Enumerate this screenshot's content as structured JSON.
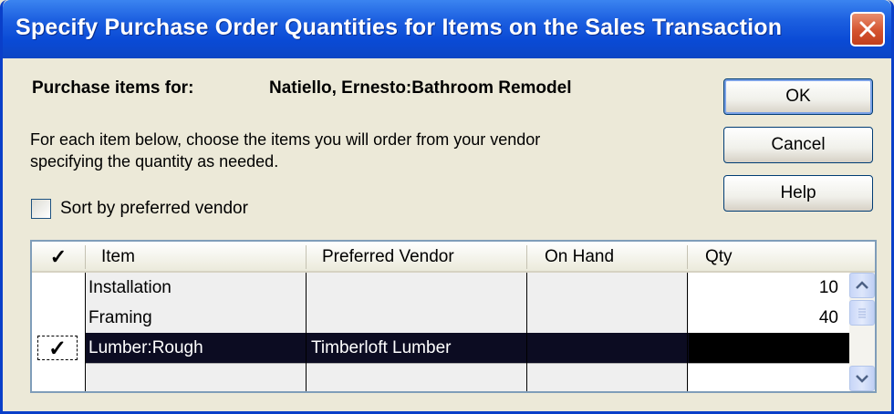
{
  "window": {
    "title": "Specify Purchase Order Quantities for Items on the Sales Transaction",
    "close_icon": "close-x-icon"
  },
  "form": {
    "purchase_label": "Purchase items for:",
    "customer_job": "Natiello, Ernesto:Bathroom Remodel",
    "instructions": "For each item below, choose the items you will order from your vendor specifying the quantity as needed.",
    "sort_label": "Sort by preferred vendor",
    "sort_checked": false
  },
  "buttons": {
    "ok": "OK",
    "cancel": "Cancel",
    "help": "Help"
  },
  "table": {
    "columns": {
      "check": "✓",
      "item": "Item",
      "vendor": "Preferred Vendor",
      "on_hand": "On Hand",
      "qty": "Qty"
    },
    "rows": [
      {
        "checked": "",
        "item": "Installation",
        "vendor": "",
        "on_hand": "",
        "qty": "10"
      },
      {
        "checked": "",
        "item": "Framing",
        "vendor": "",
        "on_hand": "",
        "qty": "40"
      },
      {
        "checked": "✓",
        "item": "Lumber:Rough",
        "vendor": "Timberloft Lumber",
        "on_hand": "",
        "qty": "",
        "selected": true
      },
      {
        "checked": "",
        "item": "",
        "vendor": "",
        "on_hand": "",
        "qty": ""
      }
    ]
  },
  "colors": {
    "title_bar": "#0a4ad5",
    "selected_row": "#0c0c22",
    "dialog_bg": "#ece9d8"
  }
}
